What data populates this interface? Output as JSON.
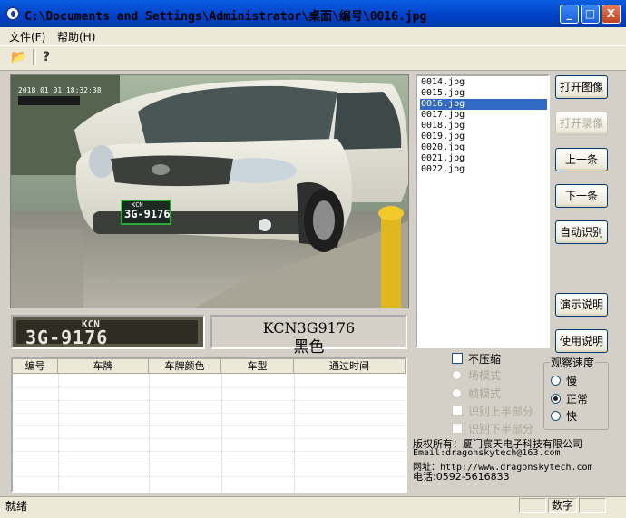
{
  "window": {
    "title": "C:\\Documents and Settings\\Administrator\\桌面\\编号\\0016.jpg"
  },
  "titlebar_buttons": {
    "minimize": "_",
    "maximize": "□",
    "close": "X"
  },
  "menu": [
    {
      "label": "文件(F)"
    },
    {
      "label": "帮助(H)"
    }
  ],
  "toolbar": [
    {
      "icon": "open-folder-icon",
      "glyph": "📂"
    },
    {
      "icon": "help-icon",
      "glyph": "?"
    }
  ],
  "photo": {
    "timestamp": "2018 01 01 18:32:38",
    "overlay_plate": "KCN",
    "overlay_number": "3G-9176"
  },
  "result": {
    "plate_crop_top": "KCN",
    "plate_crop_number": "3G-9176",
    "plate_text": "KCN3G9176",
    "plate_color": "黑色"
  },
  "table": {
    "headers": [
      "编号",
      "车牌",
      "车牌颜色",
      "车型",
      "通过时间"
    ],
    "rows": []
  },
  "files": {
    "items": [
      "0014.jpg",
      "0015.jpg",
      "0016.jpg",
      "0017.jpg",
      "0018.jpg",
      "0019.jpg",
      "0020.jpg",
      "0021.jpg",
      "0022.jpg"
    ],
    "selected": "0016.jpg"
  },
  "buttons": {
    "open_image": "打开图像",
    "open_video": "打开录像",
    "prev": "上一条",
    "next": "下一条",
    "auto_recognize": "自动识别",
    "demo": "演示说明",
    "usage": "使用说明"
  },
  "options": {
    "no_compress": "不压缩",
    "field_mode": "场模式",
    "frame_mode": "帧模式",
    "recognize_upper": "识别上半部分",
    "recognize_lower": "识别下半部分"
  },
  "speed": {
    "title": "观察速度",
    "options": [
      "慢",
      "正常",
      "快"
    ],
    "selected": "正常"
  },
  "copyright": {
    "line1": "版权所有：厦门宸天电子科技有限公司",
    "line2": "Email:dragonskytech@163.com",
    "line3": "网址：http://www.dragonskytech.com",
    "line4": "电话:0592-5616833"
  },
  "status": {
    "text": "就绪",
    "panel2": "数字"
  }
}
